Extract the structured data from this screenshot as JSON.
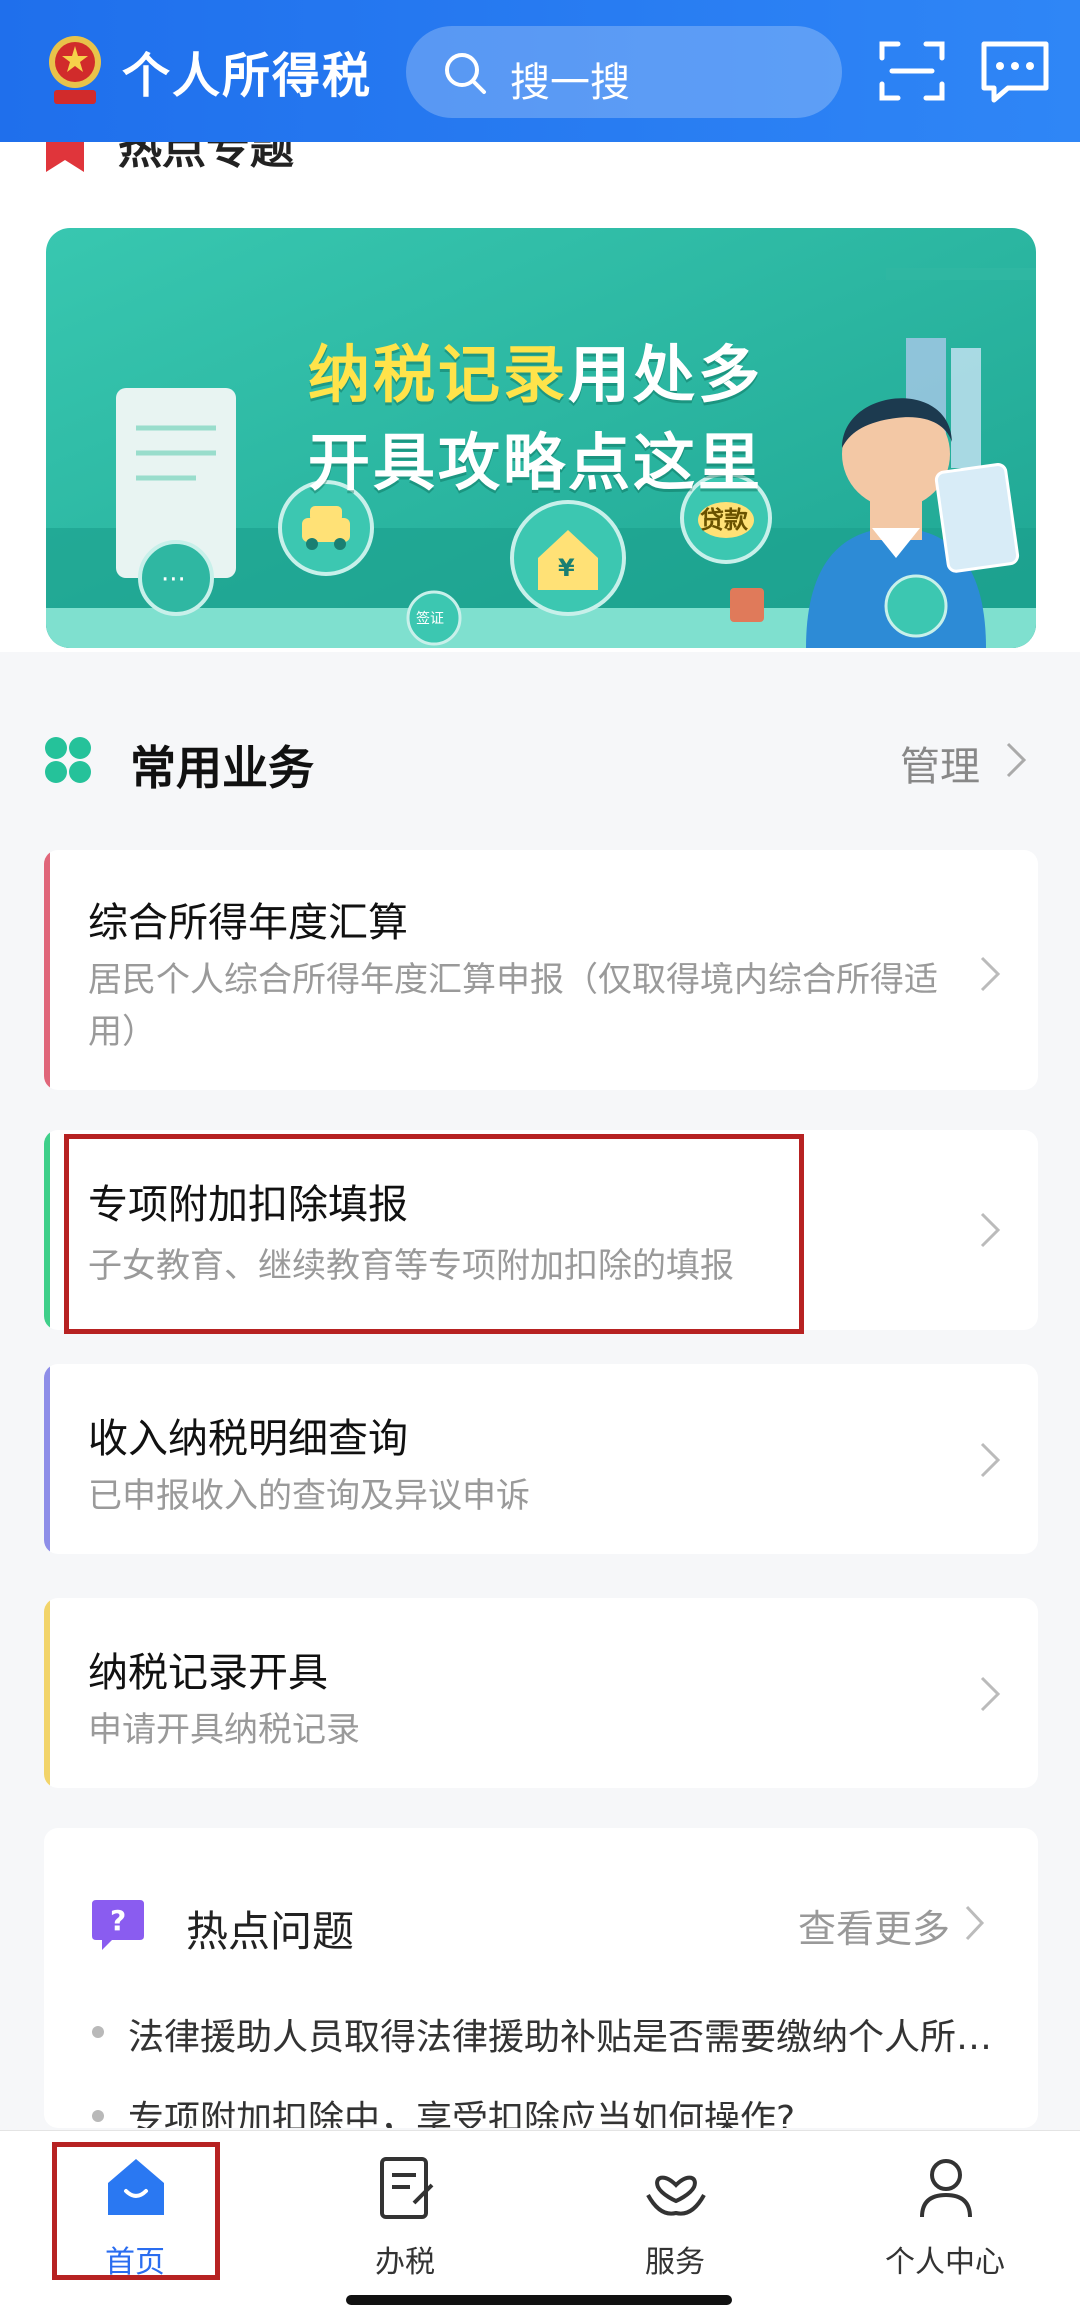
{
  "header": {
    "app_title": "个人所得税",
    "search_placeholder": "搜一搜",
    "accent": "#2a78f2"
  },
  "topic": {
    "title": "热点专题"
  },
  "banner": {
    "line1_highlight": "纳税记录",
    "line1_rest": "用处多",
    "line2": "开具攻略点这里",
    "loan_badge": "贷款",
    "visa_badge": "签证"
  },
  "section": {
    "title": "常用业务",
    "manage_label": "管理"
  },
  "cards": [
    {
      "title": "综合所得年度汇算",
      "desc": "居民个人综合所得年度汇算申报（仅取得境内综合所得适用）",
      "color": "#e0667a"
    },
    {
      "title": "专项附加扣除填报",
      "desc": "子女教育、继续教育等专项附加扣除的填报",
      "color": "#3fcf8a"
    },
    {
      "title": "收入纳税明细查询",
      "desc": "已申报收入的查询及异议申诉",
      "color": "#8e8ee8"
    },
    {
      "title": "纳税记录开具",
      "desc": "申请开具纳税记录",
      "color": "#f2d46a"
    }
  ],
  "faq": {
    "title": "热点问题",
    "more_label": "查看更多",
    "items": [
      "法律援助人员取得法律援助补贴是否需要缴纳个人所…",
      "专项附加扣除中，享受扣除应当如何操作?"
    ]
  },
  "nav": [
    {
      "label": "首页",
      "icon": "home-icon",
      "active": true
    },
    {
      "label": "办税",
      "icon": "tax-form-icon",
      "active": false
    },
    {
      "label": "服务",
      "icon": "heart-hands-icon",
      "active": false
    },
    {
      "label": "个人中心",
      "icon": "person-icon",
      "active": false
    }
  ]
}
